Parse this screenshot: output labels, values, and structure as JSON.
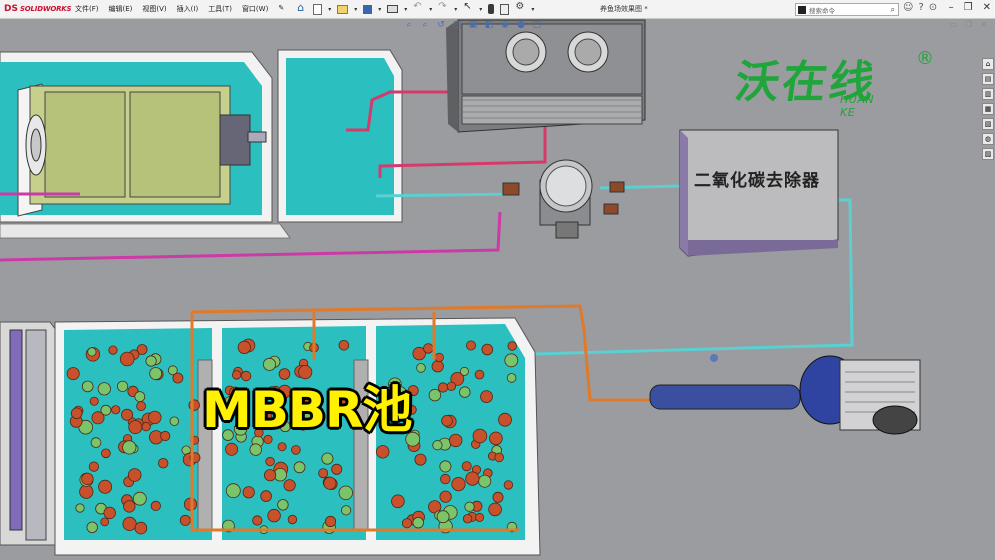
{
  "app": {
    "brand": "SOLIDWORKS",
    "ds_mark": "DS",
    "document_title": "养鱼场效果图 *"
  },
  "menu": [
    "文件(F)",
    "编辑(E)",
    "视图(V)",
    "插入(I)",
    "工具(T)",
    "窗口(W)"
  ],
  "toolbar_icons": [
    "home-icon",
    "new-document-icon",
    "open-icon",
    "save-icon",
    "print-icon",
    "undo-icon",
    "redo-icon",
    "select-icon",
    "rebuild-icon",
    "file-properties-icon",
    "options-icon"
  ],
  "search": {
    "placeholder": "搜索命令"
  },
  "window_buttons": {
    "minimize": "–",
    "restore": "❐",
    "close": "✕"
  },
  "help_icons": {
    "user": "☺",
    "help": "?",
    "more": "⊙"
  },
  "watermark": {
    "text": "沃在线",
    "subtext": "HUAN KE",
    "registered": "®",
    "color": "#1fa53a"
  },
  "equipment_label": "二氧化碳去除器",
  "caption": {
    "text": "MBBR池",
    "color": "#fff100"
  },
  "colors": {
    "viewport": "#9a9ca0",
    "water": "#2bbfc0",
    "pipe_orange": "#e07a2a",
    "pipe_magenta": "#cc3aa8",
    "pipe_cyan": "#5ad0d0",
    "pipe_red": "#d63a6a"
  }
}
